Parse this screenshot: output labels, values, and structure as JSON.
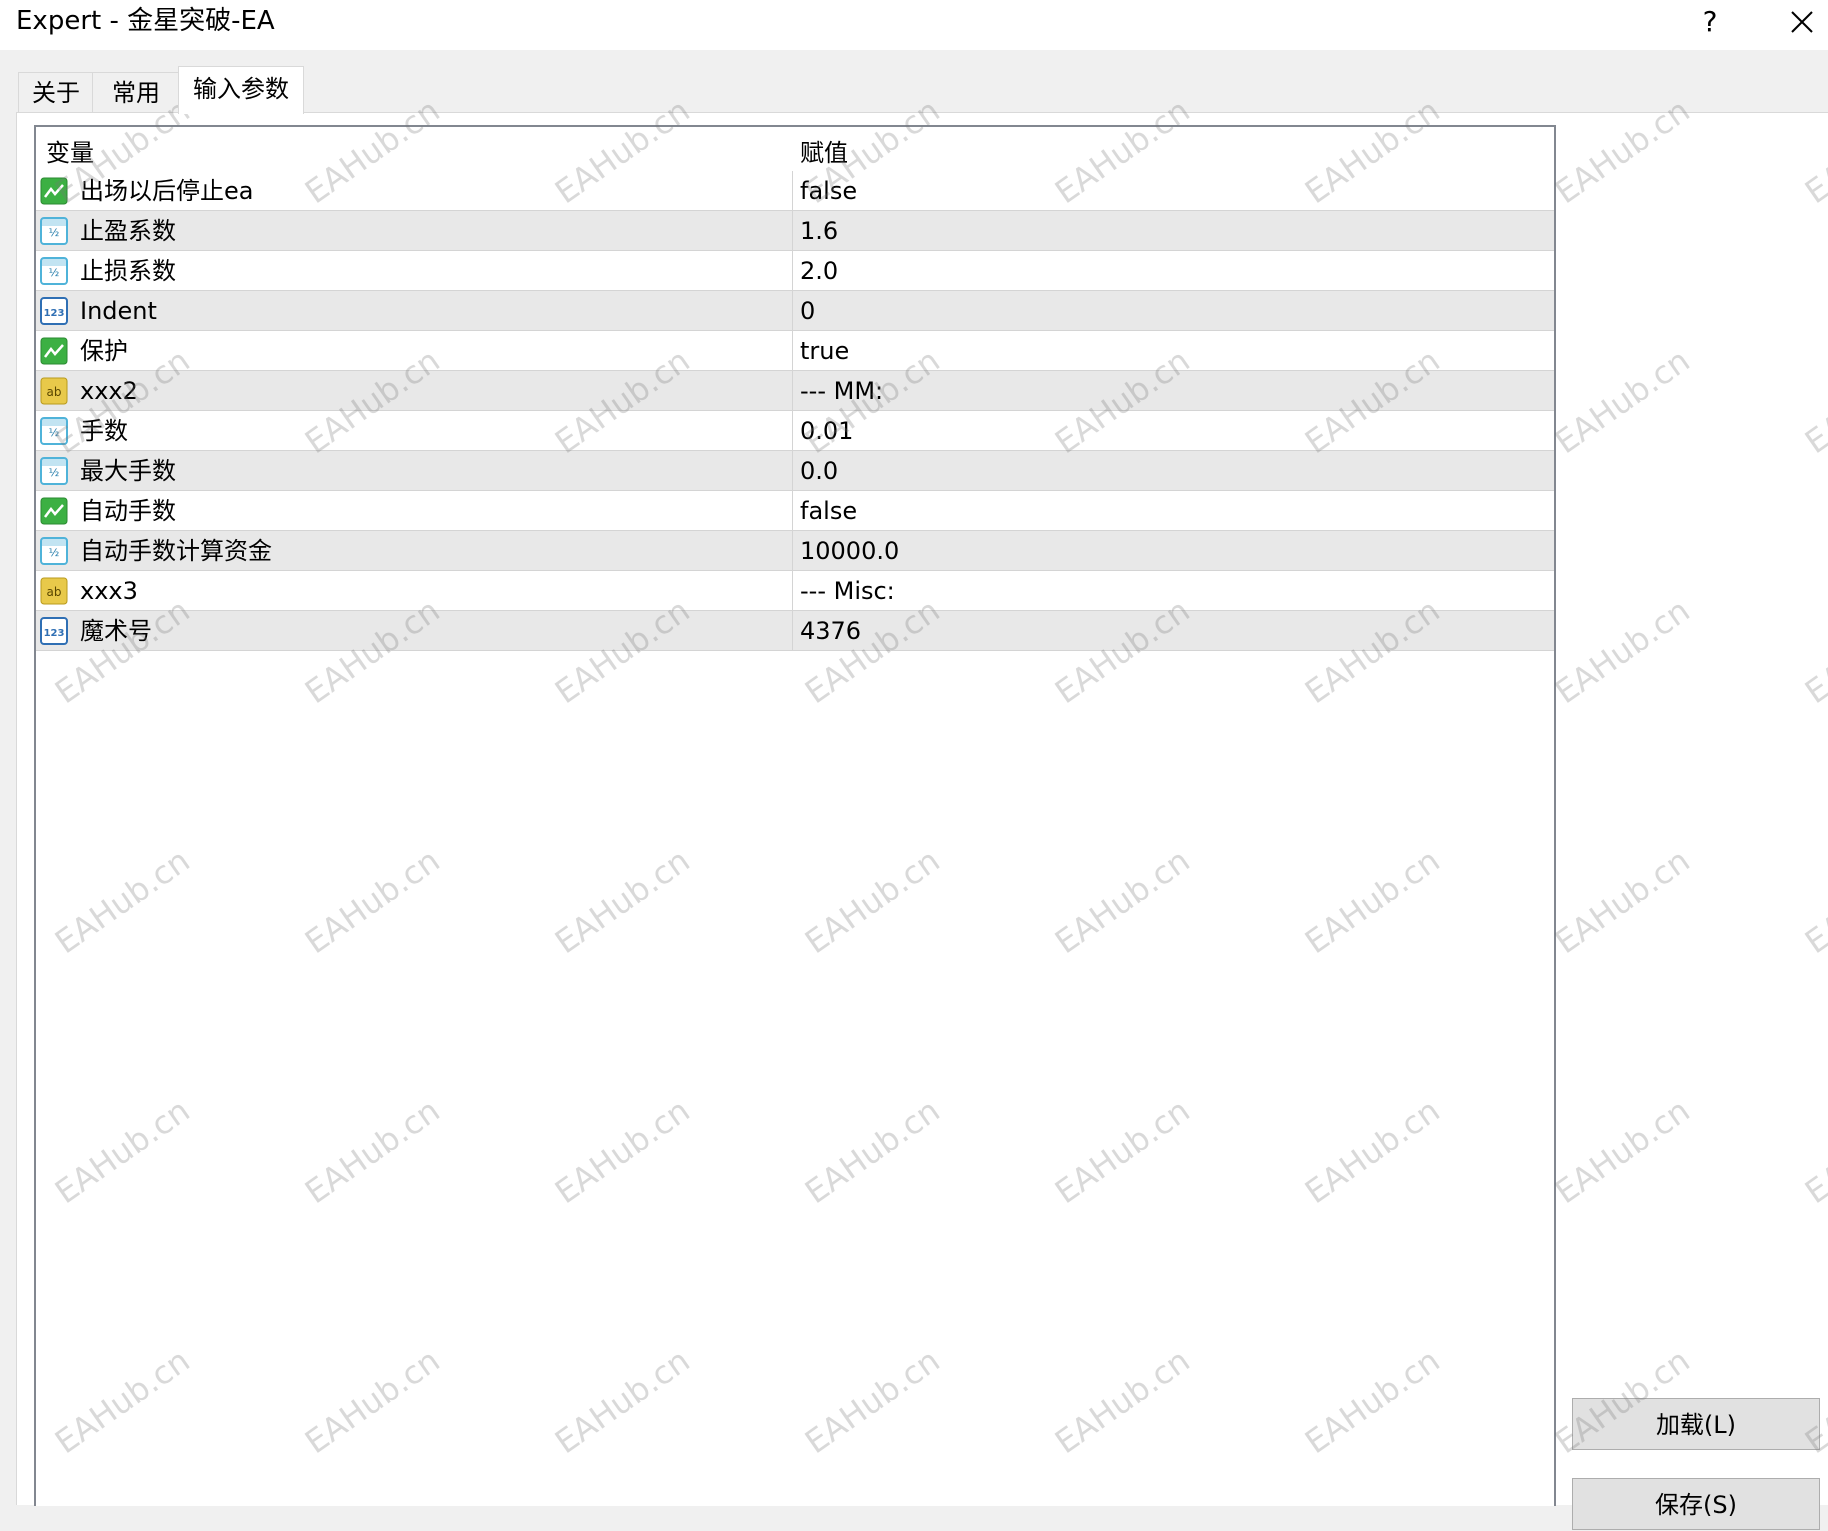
{
  "window": {
    "title": "Expert - 金星突破-EA",
    "help_label": "?"
  },
  "tabs": [
    {
      "label": "关于",
      "active": false
    },
    {
      "label": "常用",
      "active": false
    },
    {
      "label": "输入参数",
      "active": true
    }
  ],
  "grid": {
    "columns": [
      "变量",
      "赋值"
    ],
    "rows": [
      {
        "icon": "bool-icon",
        "name": "出场以后停止ea",
        "value": "false"
      },
      {
        "icon": "double-icon",
        "name": "止盈系数",
        "value": "1.6"
      },
      {
        "icon": "double-icon",
        "name": "止损系数",
        "value": "2.0"
      },
      {
        "icon": "integer-icon",
        "name": "Indent",
        "value": "0"
      },
      {
        "icon": "bool-icon",
        "name": "保护",
        "value": "true"
      },
      {
        "icon": "string-icon",
        "name": "xxx2",
        "value": "--- MM:"
      },
      {
        "icon": "double-icon",
        "name": "手数",
        "value": "0.01"
      },
      {
        "icon": "double-icon",
        "name": "最大手数",
        "value": "0.0"
      },
      {
        "icon": "bool-icon",
        "name": "自动手数",
        "value": "false"
      },
      {
        "icon": "double-icon",
        "name": "自动手数计算资金",
        "value": "10000.0"
      },
      {
        "icon": "string-icon",
        "name": "xxx3",
        "value": "--- Misc:"
      },
      {
        "icon": "integer-icon",
        "name": "魔术号",
        "value": "4376"
      }
    ]
  },
  "buttons": {
    "load_label": "加载(L)",
    "save_label": "保存(S)"
  },
  "watermark": {
    "text": "EAHub.cn"
  },
  "colors": {
    "row_alt": "#e8e8e8",
    "bool_icon": "#3cb043",
    "double_icon": "#4fb3d9",
    "integer_icon": "#2f6fb4",
    "string_icon": "#e8c94a"
  }
}
